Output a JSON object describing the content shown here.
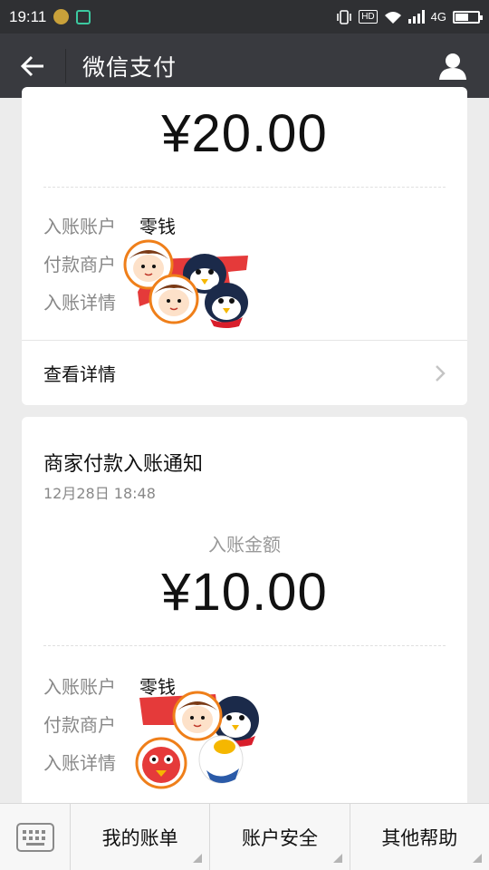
{
  "status_bar": {
    "time": "19:11",
    "hd": "HD",
    "network": "4G",
    "battery_level": 0.6
  },
  "header": {
    "title": "微信支付",
    "back_icon": "arrow-left-icon",
    "profile_icon": "person-icon"
  },
  "card1": {
    "amount": "¥20.00",
    "rows": [
      {
        "label": "入账账户",
        "value": "零钱"
      },
      {
        "label": "付款商户",
        "value": ""
      },
      {
        "label": "入账详情",
        "value": ""
      }
    ],
    "details_label": "查看详情"
  },
  "card2": {
    "title": "商家付款入账通知",
    "date": "12月28日  18:48",
    "amount_label": "入账金额",
    "amount": "¥10.00",
    "rows": [
      {
        "label": "入账账户",
        "value": "零钱"
      },
      {
        "label": "付款商户",
        "value": ""
      },
      {
        "label": "入账详情",
        "value": ""
      }
    ]
  },
  "bottom_menu": {
    "keyboard_icon": "keyboard-icon",
    "items": [
      {
        "label": "我的账单"
      },
      {
        "label": "账户安全"
      },
      {
        "label": "其他帮助"
      }
    ]
  },
  "colors": {
    "title_bar": "#393a3f",
    "status_bar": "#2f3033",
    "background": "#ececec"
  }
}
